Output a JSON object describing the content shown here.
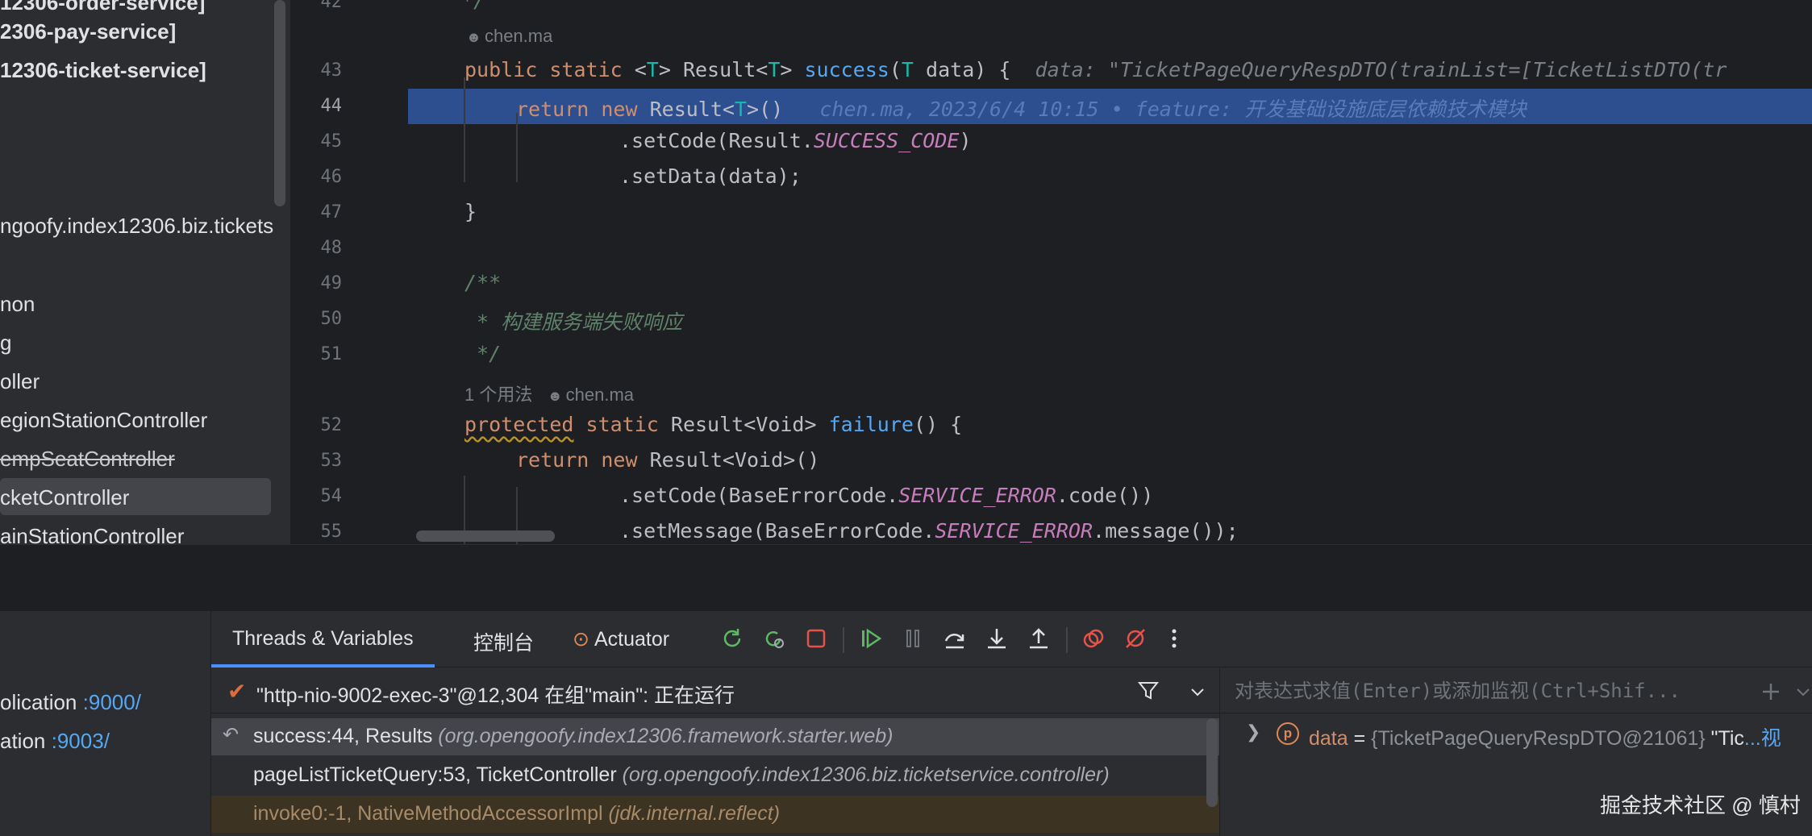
{
  "project_tree": {
    "items": [
      {
        "text": "12306-order-service]",
        "bold": true
      },
      {
        "text": "2306-pay-service]",
        "bold": true
      },
      {
        "text": "12306-ticket-service]",
        "bold": true
      },
      {
        "text": "ngoofy.index12306.biz.tickets",
        "bold": false
      },
      {
        "text": "non",
        "bold": false
      },
      {
        "text": "g",
        "bold": false
      },
      {
        "text": "oller",
        "bold": false
      },
      {
        "text": "egionStationController",
        "bold": false
      },
      {
        "text": "empSeatController",
        "bold": false,
        "strike": true
      },
      {
        "text": "cketController",
        "bold": false,
        "selected": true
      },
      {
        "text": "ainStationController",
        "bold": false
      }
    ]
  },
  "editor": {
    "line_numbers": [
      "42",
      "43",
      "44",
      "45",
      "46",
      "47",
      "48",
      "49",
      "50",
      "51",
      "52",
      "53",
      "54",
      "55"
    ],
    "current_line": "44",
    "lens_author_1": "chen.ma",
    "lens_usages_2": "1 个用法",
    "lens_author_2": "chen.ma",
    "line_42": "*/",
    "line_43_kw": "public static",
    "line_43_type": "Result",
    "line_43_fn": "success",
    "line_43_param": "data",
    "line_43_hint": "data: \"TicketPageQueryRespDTO(trainList=[TicketListDTO(tr",
    "line_44_kw1": "return",
    "line_44_kw2": "new",
    "line_44_type": "Result",
    "line_44_blame": "chen.ma, 2023/6/4 10:15 • feature: 开发基础设施底层依赖技术模块",
    "line_45_call": ".setCode(Result.",
    "line_45_const": "SUCCESS_CODE",
    "line_46_call": ".setData(data);",
    "line_47": "}",
    "line_49": "/**",
    "line_50": " * 构建服务端失败响应",
    "line_51": " */",
    "line_52_kw1": "protected",
    "line_52_kw2": "static",
    "line_52_type": "Result<Void>",
    "line_52_fn": "failure",
    "line_53_kw1": "return",
    "line_53_kw2": "new",
    "line_53_type": "Result<Void>()",
    "line_54_call": ".setCode(BaseErrorCode.",
    "line_54_const": "SERVICE_ERROR",
    "line_54_tail": ".code())",
    "line_55_call": ".setMessage(BaseErrorCode.",
    "line_55_const": "SERVICE_ERROR",
    "line_55_tail": ".message());"
  },
  "services": {
    "items": [
      {
        "name": "olication",
        "port": ":9000/"
      },
      {
        "name": "ation",
        "port": ":9003/"
      }
    ]
  },
  "debug": {
    "tabs": [
      {
        "label": "Threads & Variables",
        "active": true
      },
      {
        "label": "控制台",
        "active": false
      },
      {
        "label": "Actuator",
        "active": false
      }
    ],
    "thread_label": "\"http-nio-9002-exec-3\"@12,304 在组\"main\": 正在运行",
    "frames": [
      {
        "method": "success:44, Results",
        "package": "(org.opengoofy.index12306.framework.starter.web)",
        "state": "selected"
      },
      {
        "method": "pageListTicketQuery:53, TicketController",
        "package": "(org.opengoofy.index12306.biz.ticketservice.controller)",
        "state": "normal"
      },
      {
        "method": "invoke0:-1, NativeMethodAccessorImpl",
        "package": "(jdk.internal.reflect)",
        "state": "library"
      }
    ],
    "eval_placeholder": "对表达式求值(Enter)或添加监视(Ctrl+Shif...",
    "variable": {
      "badge": "p",
      "name": "data",
      "eq": " = ",
      "value": "{TicketPageQueryRespDTO@21061}",
      "preview": " \"Tic",
      "link": "...视"
    }
  },
  "watermark": "掘金技术社区 @ 慎村",
  "colors": {
    "editor_bg": "#1e1f22",
    "panel_bg": "#2b2d30",
    "exec_line": "#2d4f8f",
    "keyword": "#cf8e6d",
    "function": "#56a8f5",
    "constant": "#c77dbb",
    "type_param": "#16baac",
    "comment": "#5f826b",
    "accent": "#4a8eff"
  },
  "icons": [
    "person-icon",
    "actuator-icon",
    "rerun-icon",
    "restart-icon",
    "stop-icon",
    "resume-icon",
    "pause-icon",
    "step-over-icon",
    "step-into-icon",
    "step-out-icon",
    "view-breakpoints-icon",
    "mute-breakpoints-icon",
    "more-icon",
    "filter-icon",
    "chevron-down-icon",
    "add-watch-icon",
    "check-icon",
    "return-arrow-icon",
    "expand-chevron-icon"
  ]
}
